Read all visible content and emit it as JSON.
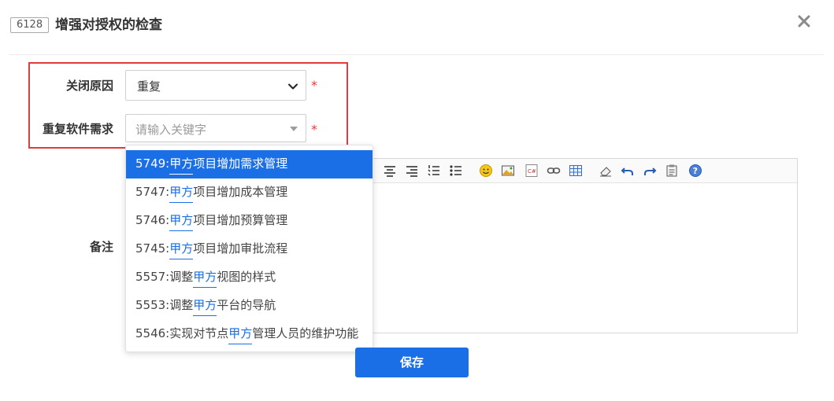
{
  "header": {
    "id_badge": "6128",
    "title": "增强对授权的检查",
    "close_icon": "close-icon"
  },
  "form": {
    "close_reason": {
      "label": "关闭原因",
      "value": "重复",
      "required_mark": "*"
    },
    "duplicate_story": {
      "label": "重复软件需求",
      "placeholder": "请输入关键字",
      "required_mark": "*"
    },
    "note": {
      "label": "备注"
    }
  },
  "dropdown": {
    "options": [
      {
        "prefix": "5749:",
        "highlight": "甲方",
        "suffix": "项目增加需求管理",
        "active": true
      },
      {
        "prefix": "5747:",
        "highlight": "甲方",
        "suffix": "项目增加成本管理",
        "active": false
      },
      {
        "prefix": "5746:",
        "highlight": "甲方",
        "suffix": "项目增加预算管理",
        "active": false
      },
      {
        "prefix": "5745:",
        "highlight": "甲方",
        "suffix": "项目增加审批流程",
        "active": false
      },
      {
        "prefix": "5557:调整",
        "highlight": "甲方",
        "suffix": "视图的样式",
        "active": false
      },
      {
        "prefix": "5553:调整",
        "highlight": "甲方",
        "suffix": "平台的导航",
        "active": false
      },
      {
        "prefix": "5546:实现对节点",
        "highlight": "甲方",
        "suffix": "管理人员的维护功能",
        "active": false
      }
    ]
  },
  "editor": {
    "toolbar_icons": [
      "align-center-icon",
      "align-right-icon",
      "ordered-list-icon",
      "unordered-list-icon",
      "emoji-icon",
      "image-icon",
      "code-icon",
      "link-icon",
      "table-icon",
      "eraser-icon",
      "undo-icon",
      "redo-icon",
      "paste-icon",
      "help-icon"
    ]
  },
  "actions": {
    "save_label": "保存"
  },
  "colors": {
    "primary": "#1a6fe6",
    "required": "#e23b3b",
    "highlight_box": "#e23b3b"
  }
}
